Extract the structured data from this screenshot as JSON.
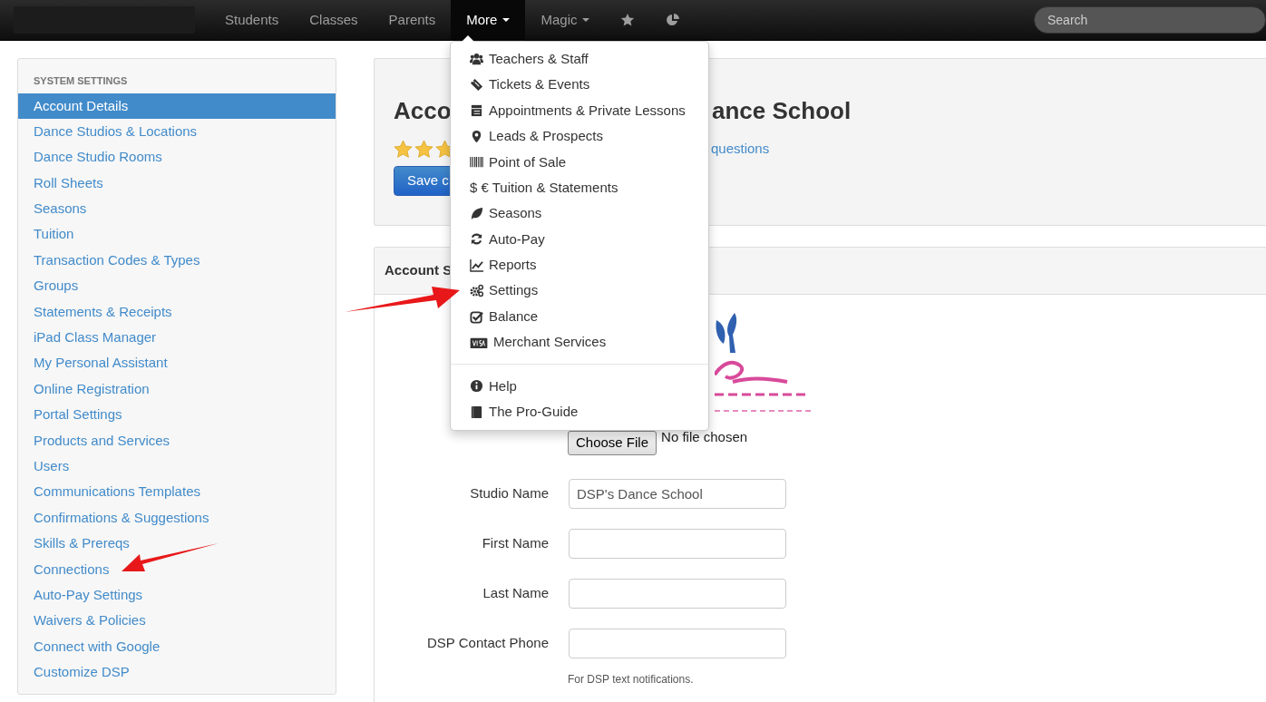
{
  "navbar": {
    "items": [
      {
        "label": "Students",
        "selected": false,
        "dropdown": false
      },
      {
        "label": "Classes",
        "selected": false,
        "dropdown": false
      },
      {
        "label": "Parents",
        "selected": false,
        "dropdown": false
      },
      {
        "label": "More",
        "selected": true,
        "dropdown": true
      },
      {
        "label": "Magic",
        "selected": false,
        "dropdown": true
      }
    ],
    "search": {
      "placeholder": "Search"
    }
  },
  "dropdown_menu": {
    "groups": [
      [
        {
          "label": "Teachers & Staff"
        },
        {
          "label": "Tickets & Events"
        },
        {
          "label": "Appointments & Private Lessons"
        },
        {
          "label": "Leads & Prospects"
        },
        {
          "label": "Point of Sale"
        },
        {
          "symbol_text": "$ €",
          "label": "Tuition & Statements"
        },
        {
          "label": "Seasons"
        },
        {
          "label": "Auto-Pay"
        },
        {
          "label": "Reports"
        },
        {
          "label": "Settings"
        },
        {
          "label": "Balance"
        },
        {
          "label": "Merchant Services"
        }
      ],
      [
        {
          "label": "Help"
        },
        {
          "label": "The Pro-Guide"
        }
      ]
    ]
  },
  "sidebar": {
    "heading": "SYSTEM SETTINGS",
    "items": [
      {
        "label": "Account Details",
        "selected": true
      },
      {
        "label": "Dance Studios & Locations",
        "selected": false
      },
      {
        "label": "Dance Studio Rooms",
        "selected": false
      },
      {
        "label": "Roll Sheets",
        "selected": false
      },
      {
        "label": "Seasons",
        "selected": false
      },
      {
        "label": "Tuition",
        "selected": false
      },
      {
        "label": "Transaction Codes & Types",
        "selected": false
      },
      {
        "label": "Groups",
        "selected": false
      },
      {
        "label": "Statements & Receipts",
        "selected": false
      },
      {
        "label": "iPad Class Manager",
        "selected": false
      },
      {
        "label": "My Personal Assistant",
        "selected": false
      },
      {
        "label": "Online Registration",
        "selected": false
      },
      {
        "label": "Portal Settings",
        "selected": false
      },
      {
        "label": "Products and Services",
        "selected": false
      },
      {
        "label": "Users",
        "selected": false
      },
      {
        "label": "Communications Templates",
        "selected": false
      },
      {
        "label": "Confirmations & Suggestions",
        "selected": false
      },
      {
        "label": "Skills & Prereqs",
        "selected": false
      },
      {
        "label": "Connections",
        "selected": false
      },
      {
        "label": "Auto-Pay Settings",
        "selected": false
      },
      {
        "label": "Waivers & Policies",
        "selected": false
      },
      {
        "label": "Connect with Google",
        "selected": false
      },
      {
        "label": "Customize DSP",
        "selected": false
      }
    ]
  },
  "header_card": {
    "title_start": "Acco",
    "title_end": "ance School",
    "stars": 3,
    "link_end": "questions",
    "save_button": "Save c"
  },
  "settings_card": {
    "header": "Account S",
    "file_input": {
      "button": "Choose File",
      "status": "No file chosen"
    },
    "fields": [
      {
        "label": "Studio Name",
        "value": "DSP's Dance School"
      },
      {
        "label": "First Name"
      },
      {
        "label": "Last Name"
      },
      {
        "label": "DSP Contact Phone"
      }
    ],
    "help": "For DSP text notifications."
  }
}
